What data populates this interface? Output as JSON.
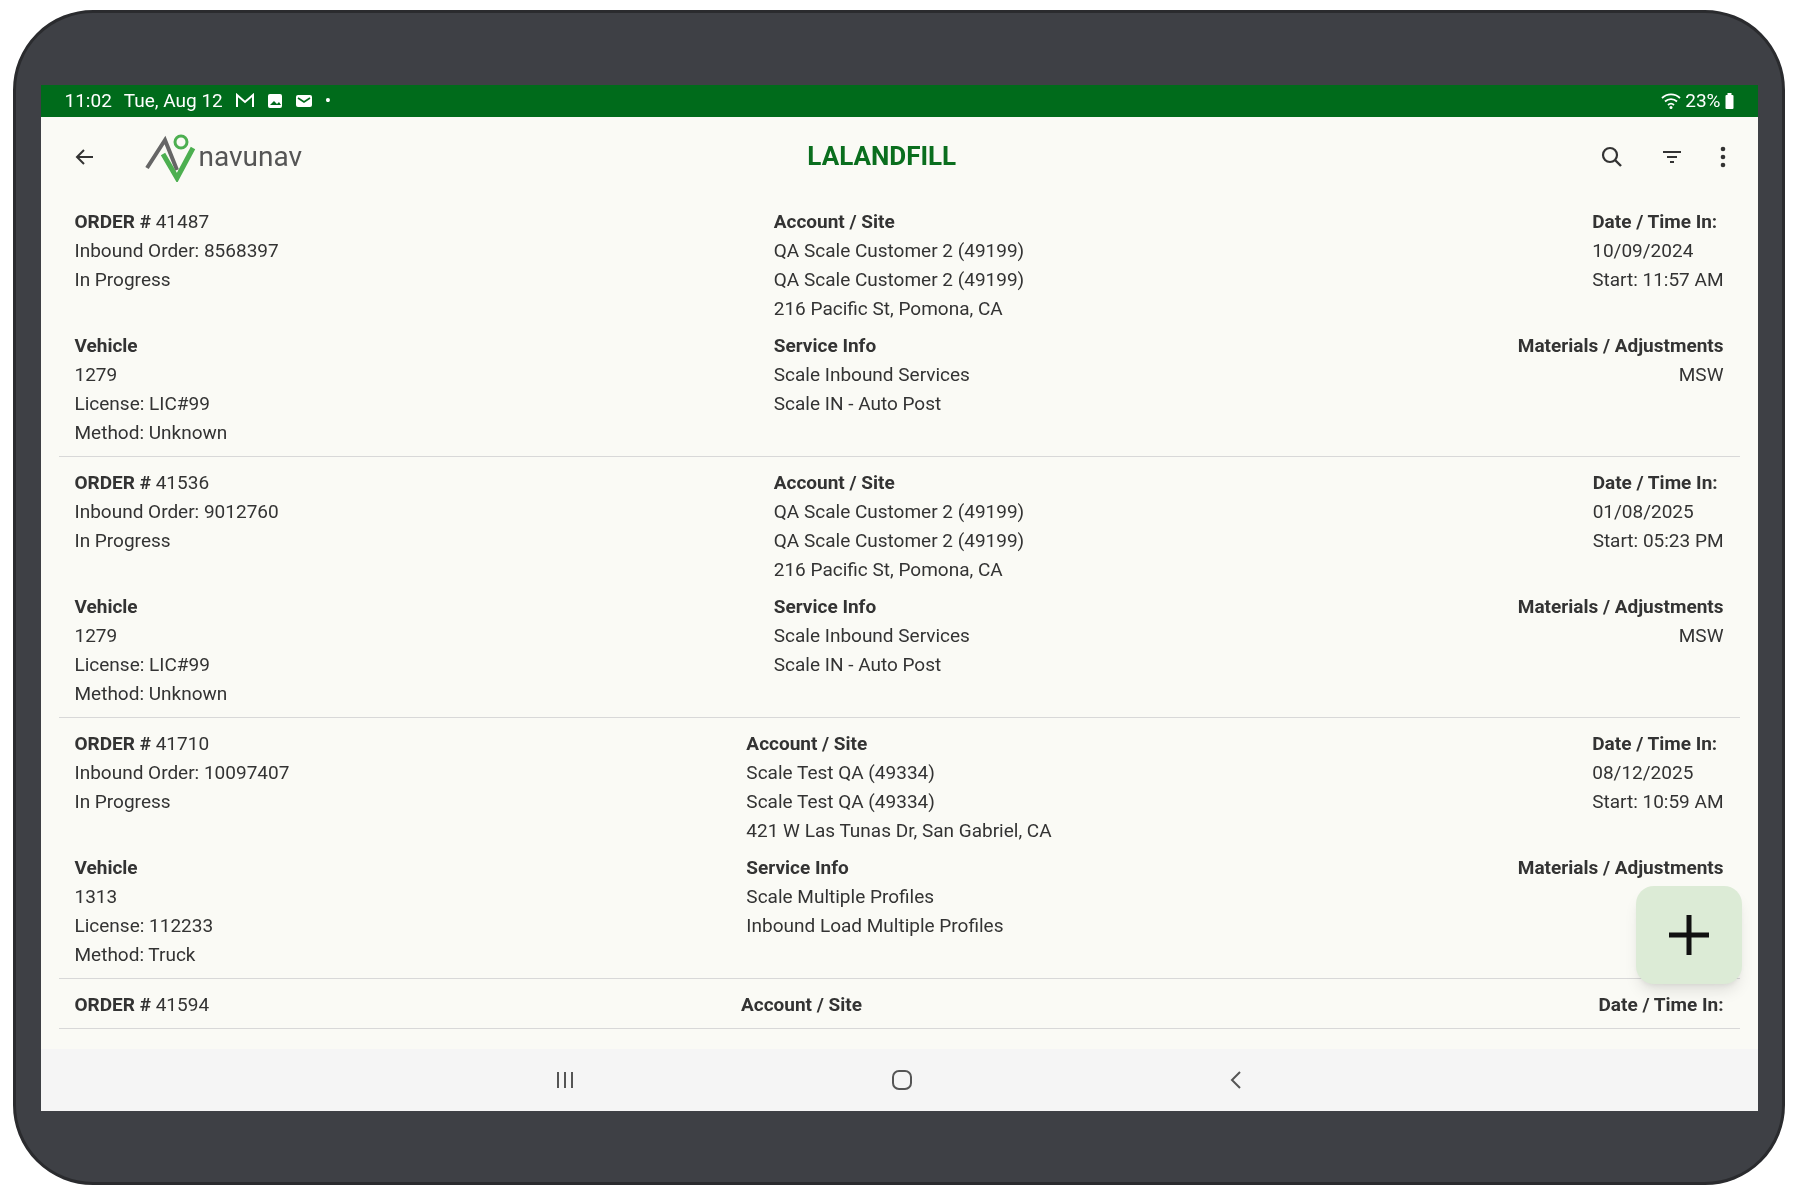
{
  "status_bar": {
    "time": "11:02",
    "date": "Tue, Aug 12",
    "dot": "•",
    "battery": "23%"
  },
  "app_bar": {
    "title": "LALANDFILL",
    "logo_text": "navunav"
  },
  "orders": [
    {
      "order_label": "ORDER #",
      "order_number": "41487",
      "inbound": "Inbound Order: 8568397",
      "status": "In Progress",
      "account_heading": "Account / Site",
      "account_lines": [
        "QA Scale Customer 2 (49199)",
        "QA Scale Customer 2 (49199)",
        "216 Pacific St, Pomona, CA"
      ],
      "date_heading": "Date / Time In:",
      "date": "10/09/2024",
      "start": "Start: 11:57 AM",
      "vehicle_heading": "Vehicle",
      "vehicle_lines": [
        "1279",
        "License: LIC#99",
        "Method: Unknown"
      ],
      "service_heading": "Service Info",
      "service_lines": [
        "Scale Inbound Services",
        "Scale IN - Auto Post"
      ],
      "materials_heading": "Materials / Adjustments",
      "materials": [
        "MSW"
      ]
    },
    {
      "order_label": "ORDER #",
      "order_number": "41536",
      "inbound": "Inbound Order: 9012760",
      "status": "In Progress",
      "account_heading": "Account / Site",
      "account_lines": [
        "QA Scale Customer 2 (49199)",
        "QA Scale Customer 2 (49199)",
        "216 Pacific St, Pomona, CA"
      ],
      "date_heading": "Date / Time In:",
      "date": "01/08/2025",
      "start": "Start: 05:23 PM",
      "vehicle_heading": "Vehicle",
      "vehicle_lines": [
        "1279",
        "License: LIC#99",
        "Method: Unknown"
      ],
      "service_heading": "Service Info",
      "service_lines": [
        "Scale Inbound Services",
        "Scale IN - Auto Post"
      ],
      "materials_heading": "Materials / Adjustments",
      "materials": [
        "MSW"
      ]
    },
    {
      "order_label": "ORDER #",
      "order_number": "41710",
      "inbound": "Inbound Order: 10097407",
      "status": "In Progress",
      "account_heading": "Account / Site",
      "account_lines": [
        "Scale Test QA (49334)",
        "Scale Test QA (49334)",
        "421 W Las Tunas Dr, San Gabriel, CA"
      ],
      "date_heading": "Date / Time In:",
      "date": "08/12/2025",
      "start": "Start: 10:59 AM",
      "vehicle_heading": "Vehicle",
      "vehicle_lines": [
        "1313",
        "License: 112233",
        "Method: Truck"
      ],
      "service_heading": "Service Info",
      "service_lines": [
        "Scale Multiple Profiles",
        "Inbound Load Multiple Profiles"
      ],
      "materials_heading": "Materials / Adjustments"
    }
  ],
  "partial_order": {
    "order_label": "ORDER #",
    "order_number": "41594",
    "account_heading": "Account / Site",
    "date_heading": "Date / Time In:"
  }
}
